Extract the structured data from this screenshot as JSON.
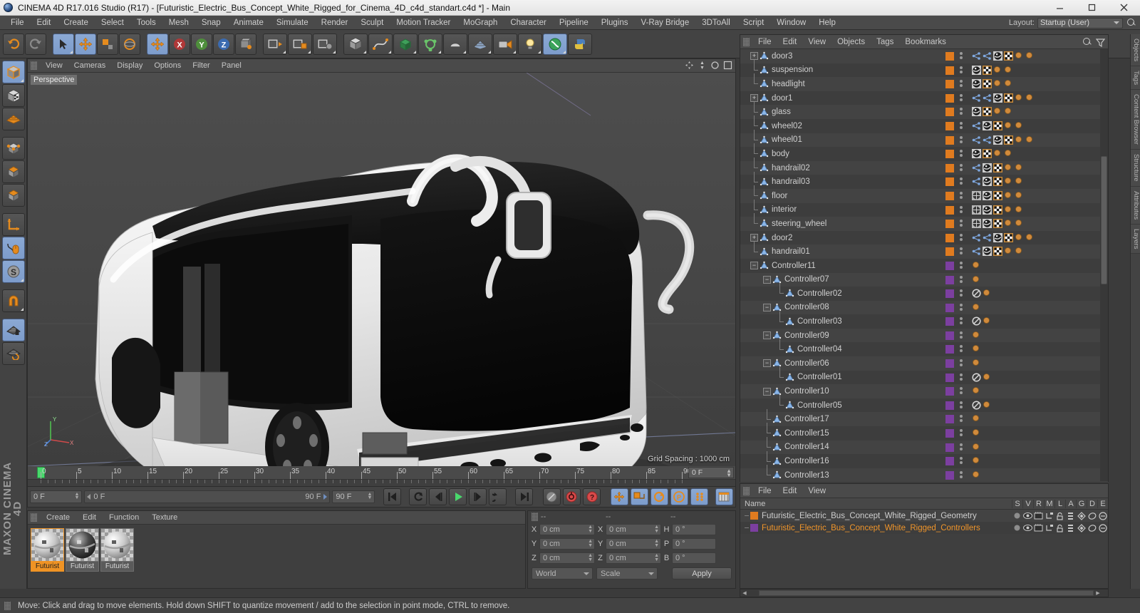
{
  "window": {
    "title": "CINEMA 4D R17.016 Studio (R17) - [Futuristic_Electric_Bus_Concept_White_Rigged_for_Cinema_4D_c4d_standart.c4d *] - Main",
    "minimize": "—",
    "maximize": "▢",
    "close": "✕"
  },
  "menubar": {
    "items": [
      "File",
      "Edit",
      "Create",
      "Select",
      "Tools",
      "Mesh",
      "Snap",
      "Animate",
      "Simulate",
      "Render",
      "Sculpt",
      "Motion Tracker",
      "MoGraph",
      "Character",
      "Pipeline",
      "Plugins",
      "V-Ray Bridge",
      "3DToAll",
      "Script",
      "Window",
      "Help"
    ],
    "layout_label": "Layout:",
    "layout_value": "Startup (User)"
  },
  "viewport": {
    "menu": [
      "View",
      "Cameras",
      "Display",
      "Options",
      "Filter",
      "Panel"
    ],
    "perspective_label": "Perspective",
    "grid_spacing": "Grid Spacing : 1000 cm",
    "axis_x": "X",
    "axis_y": "Y",
    "axis_z": "Z"
  },
  "timeline": {
    "ticks": [
      0,
      5,
      10,
      15,
      20,
      25,
      30,
      35,
      40,
      45,
      50,
      55,
      60,
      65,
      70,
      75,
      80,
      85,
      90
    ],
    "current_frame_marker": "0",
    "frame_field": "0 F"
  },
  "transport": {
    "current_frame": "0 F",
    "range_start": "0 F",
    "range_end": "90 F",
    "end_frame": "90 F",
    "buttons": [
      "go-to-start",
      "play-reverse-step",
      "step-back",
      "play",
      "step-forward",
      "loop",
      "go-to-end",
      "record-active-objects",
      "autokey",
      "keyframe-selection",
      "position",
      "scale",
      "rotation",
      "param",
      "point-level-animation",
      "timeline"
    ]
  },
  "materials": {
    "menu": [
      "Create",
      "Edit",
      "Function",
      "Texture"
    ],
    "items": [
      {
        "name": "Futurist",
        "selected": true
      },
      {
        "name": "Futurist",
        "selected": false
      },
      {
        "name": "Futurist",
        "selected": false
      }
    ]
  },
  "coordinates": {
    "headers": [
      "--",
      "--",
      "--"
    ],
    "rows": [
      {
        "l1": "X",
        "v1": "0 cm",
        "l2": "X",
        "v2": "0 cm",
        "l3": "H",
        "v3": "0 °"
      },
      {
        "l1": "Y",
        "v1": "0 cm",
        "l2": "Y",
        "v2": "0 cm",
        "l3": "P",
        "v3": "0 °"
      },
      {
        "l1": "Z",
        "v1": "0 cm",
        "l2": "Z",
        "v2": "0 cm",
        "l3": "B",
        "v3": "0 °"
      }
    ],
    "system": "World",
    "mode": "Scale",
    "apply": "Apply"
  },
  "object_manager": {
    "menu": [
      "File",
      "Edit",
      "View",
      "Objects",
      "Tags",
      "Bookmarks"
    ],
    "rows": [
      {
        "name": "door3",
        "indent": 1,
        "expand": "plus",
        "color": "#e07b1f",
        "tags": [
          "joint",
          "joint",
          "material",
          "uv",
          "dot",
          "dot"
        ]
      },
      {
        "name": "suspension",
        "indent": 1,
        "expand": "none",
        "color": "#e07b1f",
        "tags": [
          "material",
          "uv",
          "dot",
          "dot"
        ]
      },
      {
        "name": "headlight",
        "indent": 1,
        "expand": "none",
        "color": "#e07b1f",
        "tags": [
          "material",
          "uv",
          "dot",
          "dot"
        ]
      },
      {
        "name": "door1",
        "indent": 1,
        "expand": "plus",
        "color": "#e07b1f",
        "tags": [
          "joint",
          "joint",
          "material",
          "uv",
          "dot",
          "dot"
        ]
      },
      {
        "name": "glass",
        "indent": 1,
        "expand": "none",
        "color": "#e07b1f",
        "tags": [
          "material",
          "uv",
          "dot",
          "dot"
        ]
      },
      {
        "name": "wheel02",
        "indent": 1,
        "expand": "none",
        "color": "#e07b1f",
        "tags": [
          "joint",
          "material",
          "uv",
          "dot",
          "dot"
        ]
      },
      {
        "name": "wheel01",
        "indent": 1,
        "expand": "none",
        "color": "#e07b1f",
        "tags": [
          "joint",
          "joint",
          "material",
          "uv",
          "dot",
          "dot"
        ]
      },
      {
        "name": "body",
        "indent": 1,
        "expand": "none",
        "color": "#e07b1f",
        "tags": [
          "material",
          "uv",
          "dot",
          "dot"
        ]
      },
      {
        "name": "handrail02",
        "indent": 1,
        "expand": "none",
        "color": "#e07b1f",
        "tags": [
          "joint",
          "material",
          "uv",
          "dot",
          "dot"
        ]
      },
      {
        "name": "handrail03",
        "indent": 1,
        "expand": "none",
        "color": "#e07b1f",
        "tags": [
          "joint",
          "material",
          "uv",
          "dot",
          "dot"
        ]
      },
      {
        "name": "floor",
        "indent": 1,
        "expand": "none",
        "color": "#e07b1f",
        "tags": [
          "phong",
          "material",
          "uv",
          "dot",
          "dot"
        ]
      },
      {
        "name": "interior",
        "indent": 1,
        "expand": "none",
        "color": "#e07b1f",
        "tags": [
          "phong",
          "material",
          "uv",
          "dot",
          "dot"
        ]
      },
      {
        "name": "steering_wheel",
        "indent": 1,
        "expand": "none",
        "color": "#e07b1f",
        "tags": [
          "phong",
          "material",
          "uv",
          "dot",
          "dot"
        ]
      },
      {
        "name": "door2",
        "indent": 1,
        "expand": "plus",
        "color": "#e07b1f",
        "tags": [
          "joint",
          "joint",
          "material",
          "uv",
          "dot",
          "dot"
        ]
      },
      {
        "name": "handrail01",
        "indent": 1,
        "expand": "none",
        "color": "#e07b1f",
        "tags": [
          "joint",
          "material",
          "uv",
          "dot",
          "dot"
        ]
      },
      {
        "name": "Controller11",
        "indent": 1,
        "expand": "minus",
        "color": "#7c3fa0",
        "tags": [
          "dot"
        ]
      },
      {
        "name": "Controller07",
        "indent": 2,
        "expand": "minus",
        "color": "#7c3fa0",
        "tags": [
          "dot"
        ]
      },
      {
        "name": "Controller02",
        "indent": 3,
        "expand": "none",
        "color": "#7c3fa0",
        "tags": [
          "protect",
          "dot"
        ]
      },
      {
        "name": "Controller08",
        "indent": 2,
        "expand": "minus",
        "color": "#7c3fa0",
        "tags": [
          "dot"
        ]
      },
      {
        "name": "Controller03",
        "indent": 3,
        "expand": "none",
        "color": "#7c3fa0",
        "tags": [
          "protect",
          "dot"
        ]
      },
      {
        "name": "Controller09",
        "indent": 2,
        "expand": "minus",
        "color": "#7c3fa0",
        "tags": [
          "dot"
        ]
      },
      {
        "name": "Controller04",
        "indent": 3,
        "expand": "none",
        "color": "#7c3fa0",
        "tags": [
          "dot"
        ]
      },
      {
        "name": "Controller06",
        "indent": 2,
        "expand": "minus",
        "color": "#7c3fa0",
        "tags": [
          "dot"
        ]
      },
      {
        "name": "Controller01",
        "indent": 3,
        "expand": "none",
        "color": "#7c3fa0",
        "tags": [
          "protect",
          "dot"
        ]
      },
      {
        "name": "Controller10",
        "indent": 2,
        "expand": "minus",
        "color": "#7c3fa0",
        "tags": [
          "dot"
        ]
      },
      {
        "name": "Controller05",
        "indent": 3,
        "expand": "none",
        "color": "#7c3fa0",
        "tags": [
          "protect",
          "dot"
        ]
      },
      {
        "name": "Controller17",
        "indent": 2,
        "expand": "none",
        "color": "#7c3fa0",
        "tags": [
          "dot"
        ]
      },
      {
        "name": "Controller15",
        "indent": 2,
        "expand": "none",
        "color": "#7c3fa0",
        "tags": [
          "dot"
        ]
      },
      {
        "name": "Controller14",
        "indent": 2,
        "expand": "none",
        "color": "#7c3fa0",
        "tags": [
          "dot"
        ]
      },
      {
        "name": "Controller16",
        "indent": 2,
        "expand": "none",
        "color": "#7c3fa0",
        "tags": [
          "dot"
        ]
      },
      {
        "name": "Controller13",
        "indent": 2,
        "expand": "none",
        "color": "#7c3fa0",
        "tags": [
          "dot"
        ]
      }
    ]
  },
  "layer_manager": {
    "menu": [
      "File",
      "Edit",
      "View"
    ],
    "columns": [
      "Name",
      "S",
      "V",
      "R",
      "M",
      "L",
      "A",
      "G",
      "D",
      "E"
    ],
    "rows": [
      {
        "name": "Futuristic_Electric_Bus_Concept_White_Rigged_Geometry",
        "color": "#e07b1f",
        "selected": false
      },
      {
        "name": "Futuristic_Electric_Bus_Concept_White_Rigged_Controllers",
        "color": "#7c3fa0",
        "selected": true
      }
    ]
  },
  "right_tabs": [
    "Objects",
    "Tags",
    "Content Browser",
    "Structure",
    "Attributes",
    "Layers"
  ],
  "statusbar": {
    "message": "Move: Click and drag to move elements. Hold down SHIFT to quantize movement / add to the selection in point mode, CTRL to remove."
  },
  "brand": {
    "line1": "MAXON",
    "line2": "CINEMA 4D"
  },
  "colors": {
    "accent_orange": "#ef9324",
    "geometry_layer": "#e07b1f",
    "controller_layer": "#7c3fa0",
    "active_blue": "#8ba9d4",
    "play_green": "#49d86c",
    "panel_bg": "#3f3f3f"
  }
}
